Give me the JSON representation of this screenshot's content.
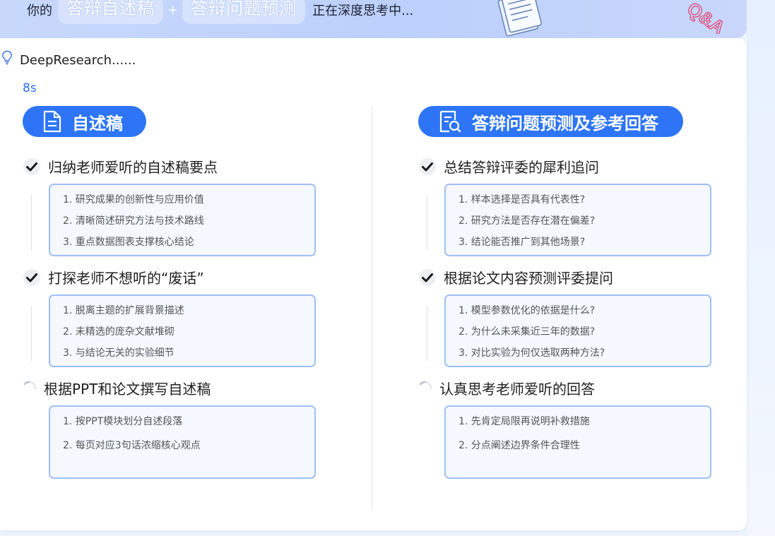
{
  "banner": {
    "prefix": "你的",
    "pill_1": "答辩自述稿",
    "plus": "+",
    "pill_2": "答辩问题预测",
    "status": "正在深度思考中..."
  },
  "panel": {
    "title": "DeepResearch......",
    "elapsed": "8s"
  },
  "left": {
    "badge": "自述稿",
    "steps": [
      {
        "label": "归纳老师爱听的自述稿要点",
        "state": "done",
        "items": [
          "1. 研究成果的创新性与应用价值",
          "2. 清晰简述研究方法与技术路线",
          "3. 重点数据图表支撑核心结论"
        ]
      },
      {
        "label": "打探老师不想听的“废话”",
        "state": "done",
        "items": [
          "1. 脱离主题的扩展背景描述",
          "2. 未精选的庞杂文献堆砌",
          "3. 与结论无关的实验细节"
        ]
      },
      {
        "label": "根据PPT和论文撰写自述稿",
        "state": "loading",
        "items": [
          "1. 按PPT模块划分自述段落",
          "2. 每页对应3句话浓缩核心观点"
        ]
      }
    ]
  },
  "right": {
    "badge": "答辩问题预测及参考回答",
    "steps": [
      {
        "label": "总结答辩评委的犀利追问",
        "state": "done",
        "items": [
          "1. 样本选择是否具有代表性?",
          "2. 研究方法是否存在潜在偏差?",
          "3. 结论能否推广到其他场景?"
        ]
      },
      {
        "label": "根据论文内容预测评委提问",
        "state": "done",
        "items": [
          "1. 模型参数优化的依据是什么?",
          "2. 为什么未采集近三年的数据?",
          "3. 对比实验为何仅选取两种方法?"
        ]
      },
      {
        "label": "认真思考老师爱听的回答",
        "state": "loading",
        "items": [
          "1. 先肯定局限再说明补救措施",
          "2. 分点阐述边界条件合理性"
        ]
      }
    ]
  },
  "colors": {
    "accent": "#2d74f6",
    "box_border": "#9fc0f5",
    "box_bg": "#f5f8ff"
  },
  "icons": [
    "bulb-icon",
    "document-icon",
    "search-document-icon",
    "check-icon",
    "spinner-icon"
  ]
}
